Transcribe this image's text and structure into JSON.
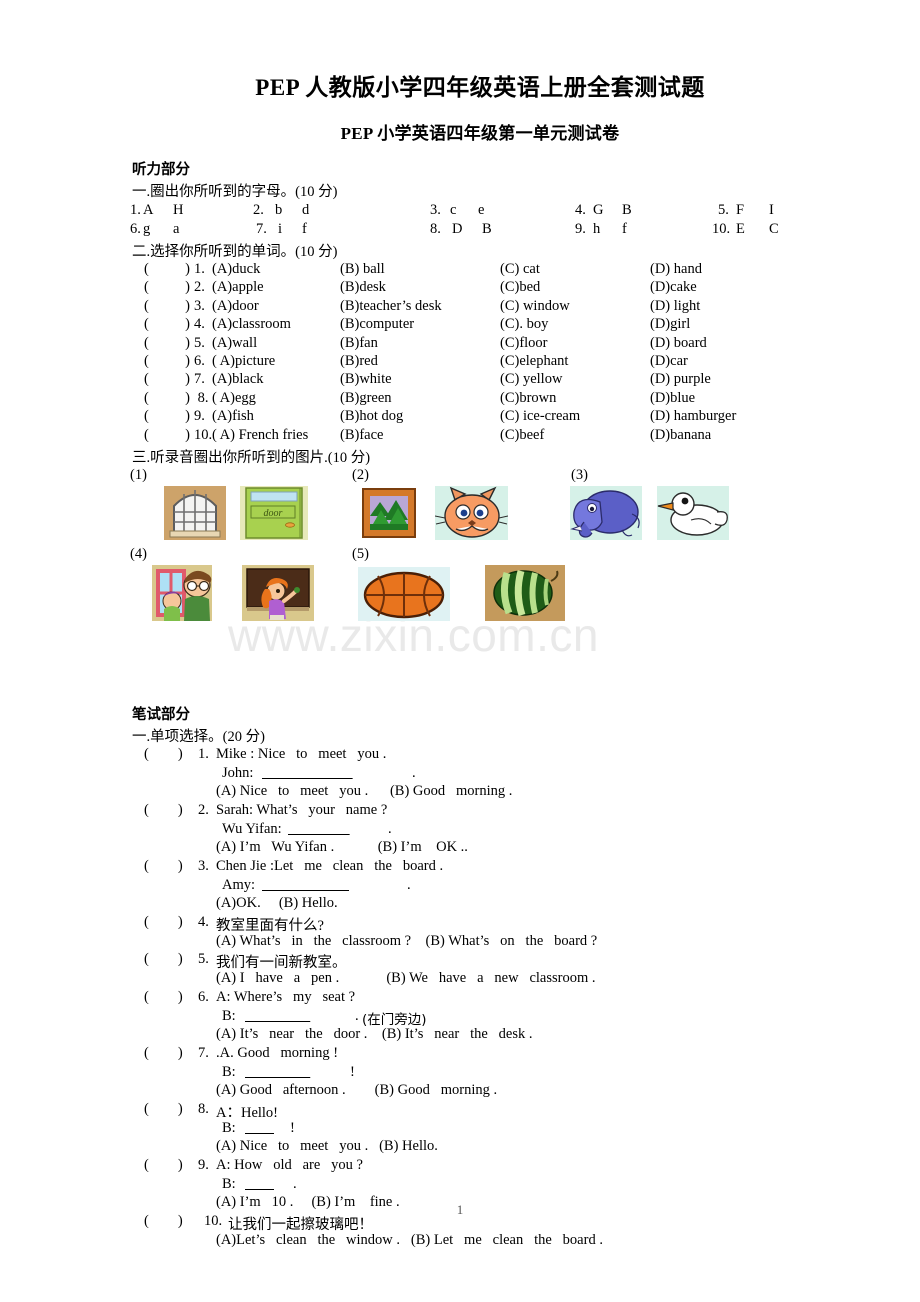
{
  "document": {
    "title": "PEP 人教版小学四年级英语上册全套测试题",
    "subtitle": "PEP 小学英语四年级第一单元测试卷",
    "page_number": "1",
    "watermark": "www.zixin.com.cn"
  },
  "listening": {
    "section_heading": "听力部分",
    "q1": {
      "prompt": "一.圈出你所听到的字母。(10 分)",
      "items": [
        {
          "num": "1.",
          "a": "A",
          "b": "H"
        },
        {
          "num": "2.",
          "a": "b",
          "b": "d"
        },
        {
          "num": "3.",
          "a": "c",
          "b": "e"
        },
        {
          "num": "4.",
          "a": "G",
          "b": "B"
        },
        {
          "num": "5.",
          "a": "F",
          "b": "I"
        },
        {
          "num": "6.",
          "a": "g",
          "b": "a"
        },
        {
          "num": "7.",
          "a": "i",
          "b": "f"
        },
        {
          "num": "8.",
          "a": "D",
          "b": "B"
        },
        {
          "num": "9.",
          "a": "h",
          "b": "f"
        },
        {
          "num": "10.",
          "a": "E",
          "b": "C"
        }
      ]
    },
    "q2": {
      "prompt": "二.选择你所听到的单词。(10 分)",
      "bracket": "(          )",
      "rows": [
        {
          "num": "1.",
          "a": "(A)duck",
          "b": "(B) ball",
          "c": "(C) cat",
          "d": "(D) hand"
        },
        {
          "num": "2. ",
          "a": "(A)apple",
          "b": "(B)desk",
          "c": "(C)bed",
          "d": "(D)cake"
        },
        {
          "num": "3.",
          "a": "(A)door",
          "b": "(B)teacher’s desk",
          "c": "(C) window",
          "d": "(D) light"
        },
        {
          "num": "4. ",
          "a": "(A)classroom",
          "b": "(B)computer",
          "c": "(C). boy",
          "d": "(D)girl"
        },
        {
          "num": "5. ",
          "a": "(A)wall",
          "b": "(B)fan",
          "c": "(C)floor",
          "d": "(D) board"
        },
        {
          "num": "6.",
          "a": "( A)picture",
          "b": "(B)red",
          "c": "(C)elephant",
          "d": "(D)car"
        },
        {
          "num": "7. ",
          "a": "(A)black",
          "b": "(B)white",
          "c": "(C) yellow",
          "d": "(D) purple"
        },
        {
          "num": " 8.",
          "a": "( A)egg",
          "b": "(B)green",
          "c": "(C)brown",
          "d": "(D)blue"
        },
        {
          "num": "9. ",
          "a": "(A)fish",
          "b": "(B)hot dog",
          "c": "(C) ice-cream",
          "d": "(D) hamburger"
        },
        {
          "num": "10.",
          "a": "( A) French fries",
          "b": "(B)face",
          "c": "(C)beef",
          "d": "(D)banana"
        }
      ]
    },
    "q3": {
      "prompt": "三.听录音圈出你所听到的图片.(10 分)",
      "groups": [
        {
          "label": "(1)",
          "pictures": [
            "window",
            "door"
          ]
        },
        {
          "label": "(2)",
          "pictures": [
            "picture-frame-trees",
            "cat-face"
          ]
        },
        {
          "label": "(3)",
          "pictures": [
            "elephant",
            "duck"
          ]
        },
        {
          "label": "(4)",
          "pictures": [
            "boy-at-window",
            "girl-at-blackboard"
          ]
        },
        {
          "label": "(5)",
          "pictures": [
            "basketball",
            "watermelon"
          ]
        }
      ]
    }
  },
  "written": {
    "section_heading": "笔试部分",
    "q1": {
      "prompt": "一.单项选择。(20 分)",
      "bracket": "(        )",
      "items": [
        {
          "num": "1.",
          "lines": [
            "Mike : Nice   to   meet   you .",
            "John: ",
            "(A) Nice   to   meet   you .      (B) Good   morning ."
          ]
        },
        {
          "num": "2.",
          "lines": [
            "Sarah: What’s   your   name ?",
            "Wu Yifan:",
            "(A) I’m   Wu Yifan .            (B) I’m    OK .."
          ]
        },
        {
          "num": "3.",
          "lines": [
            "Chen Jie :Let   me   clean   the   board .",
            "Amy: ",
            "(A)OK.     (B) Hello."
          ]
        },
        {
          "num": "4.",
          "lines": [
            "教室里面有什么?",
            "(A) What’s   in   the   classroom ?    (B) What’s   on   the   board ?"
          ]
        },
        {
          "num": "5.",
          "lines": [
            "我们有一间新教室。",
            "(A) I   have   a   pen .             (B) We   have   a   new   classroom ."
          ]
        },
        {
          "num": "6.",
          "lines": [
            "A: Where’s   my   seat ?",
            "B:",
            "(A) It’s   near   the   door .    (B) It’s   near   the   desk ."
          ]
        },
        {
          "num": "7.",
          "lines": [
            ".A. Good   morning !",
            "B:",
            "(A) Good   afternoon .        (B) Good   morning ."
          ]
        },
        {
          "num": "8.",
          "lines": [
            "A：Hello!",
            "B:",
            "(A) Nice   to   meet   you .   (B) Hello."
          ]
        },
        {
          "num": "9.",
          "lines": [
            "A: How   old   are   you ?",
            "B: ",
            "(A) I’m   10 .     (B) I’m    fine ."
          ]
        },
        {
          "num": "10.",
          "lines": [
            "让我们一起擦玻璃吧！",
            "(A)Let’s   clean   the   window .   (B) Let   me   clean   the   board ."
          ]
        }
      ],
      "q6_hint": "(在门旁边)"
    }
  }
}
